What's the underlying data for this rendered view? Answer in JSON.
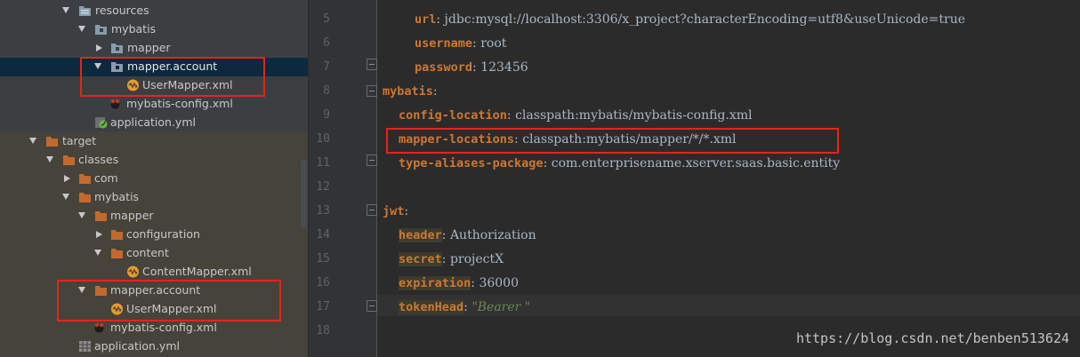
{
  "tree": {
    "items": [
      {
        "label": "resources",
        "icon": "resources-folder-icon",
        "arrow": "down",
        "selected": false
      },
      {
        "label": "mybatis",
        "icon": "package-folder-icon",
        "arrow": "down",
        "selected": false
      },
      {
        "label": "mapper",
        "icon": "package-folder-icon",
        "arrow": "right",
        "selected": false
      },
      {
        "label": "mapper.account",
        "icon": "package-folder-icon",
        "arrow": "down",
        "selected": true
      },
      {
        "label": "UserMapper.xml",
        "icon": "xml-file-icon",
        "arrow": "",
        "selected": false
      },
      {
        "label": "mybatis-config.xml",
        "icon": "mybatis-file-icon",
        "arrow": "",
        "selected": false
      },
      {
        "label": "application.yml",
        "icon": "spring-yml-icon",
        "arrow": "",
        "selected": false
      },
      {
        "label": "target",
        "icon": "folder-orange-icon",
        "arrow": "down",
        "selected": false
      },
      {
        "label": "classes",
        "icon": "folder-orange-icon",
        "arrow": "down",
        "selected": false
      },
      {
        "label": "com",
        "icon": "folder-orange-icon",
        "arrow": "right",
        "selected": false
      },
      {
        "label": "mybatis",
        "icon": "folder-orange-icon",
        "arrow": "down",
        "selected": false
      },
      {
        "label": "mapper",
        "icon": "folder-orange-icon",
        "arrow": "down",
        "selected": false
      },
      {
        "label": "configuration",
        "icon": "folder-orange-icon",
        "arrow": "right",
        "selected": false
      },
      {
        "label": "content",
        "icon": "folder-orange-icon",
        "arrow": "down",
        "selected": false
      },
      {
        "label": "ContentMapper.xml",
        "icon": "xml-file-icon",
        "arrow": "",
        "selected": false
      },
      {
        "label": "mapper.account",
        "icon": "folder-orange-icon",
        "arrow": "down",
        "selected": false
      },
      {
        "label": "UserMapper.xml",
        "icon": "xml-file-icon",
        "arrow": "",
        "selected": false
      },
      {
        "label": "mybatis-config.xml",
        "icon": "mybatis-file-icon",
        "arrow": "",
        "selected": false
      },
      {
        "label": "application.yml",
        "icon": "yml-file-icon",
        "arrow": "",
        "selected": false
      }
    ]
  },
  "editor": {
    "lines": [
      {
        "num": "5",
        "key": "url",
        "sep": ":",
        "value": " jdbc:mysql://localhost:3306/x_project?characterEncoding=utf8&useUnicode=true",
        "vtype": "v"
      },
      {
        "num": "6",
        "key": "username",
        "sep": ":",
        "value": " root",
        "vtype": "v"
      },
      {
        "num": "7",
        "key": "password",
        "sep": ":",
        "value": " 123456",
        "vtype": "v"
      },
      {
        "num": "8",
        "key": "mybatis",
        "sep": ":",
        "value": "",
        "vtype": "v"
      },
      {
        "num": "9",
        "key": "config-location",
        "sep": ":",
        "value": " classpath:mybatis/mybatis-config.xml",
        "vtype": "v"
      },
      {
        "num": "10",
        "key": "mapper-locations",
        "sep": ":",
        "value": " classpath:mybatis/mapper/*/*.xml",
        "vtype": "v"
      },
      {
        "num": "11",
        "key": "type-aliases-package",
        "sep": ":",
        "value": " com.enterprisename.xserver.saas.basic.entity",
        "vtype": "v"
      },
      {
        "num": "12",
        "key": "",
        "sep": "",
        "value": "",
        "vtype": "v"
      },
      {
        "num": "13",
        "key": "jwt",
        "sep": ":",
        "value": "",
        "vtype": "v"
      },
      {
        "num": "14",
        "key": "header",
        "sep": ":",
        "value": " Authorization",
        "vtype": "v"
      },
      {
        "num": "15",
        "key": "secret",
        "sep": ":",
        "value": " projectX",
        "vtype": "v"
      },
      {
        "num": "16",
        "key": "expiration",
        "sep": ":",
        "value": " 36000",
        "vtype": "v"
      },
      {
        "num": "17",
        "key": "tokenHead",
        "sep": ":",
        "value": " \"Bearer \"",
        "vtype": "s"
      },
      {
        "num": "18",
        "key": "",
        "sep": "",
        "value": "",
        "vtype": "v"
      }
    ]
  },
  "watermark": "https://blog.csdn.net/benben513624",
  "colors": {
    "highlight_box": "#e8231d",
    "yaml_key": "#cc7832",
    "yaml_string": "#6a8759",
    "selection": "#0d293e",
    "build_band": "#45433a"
  }
}
